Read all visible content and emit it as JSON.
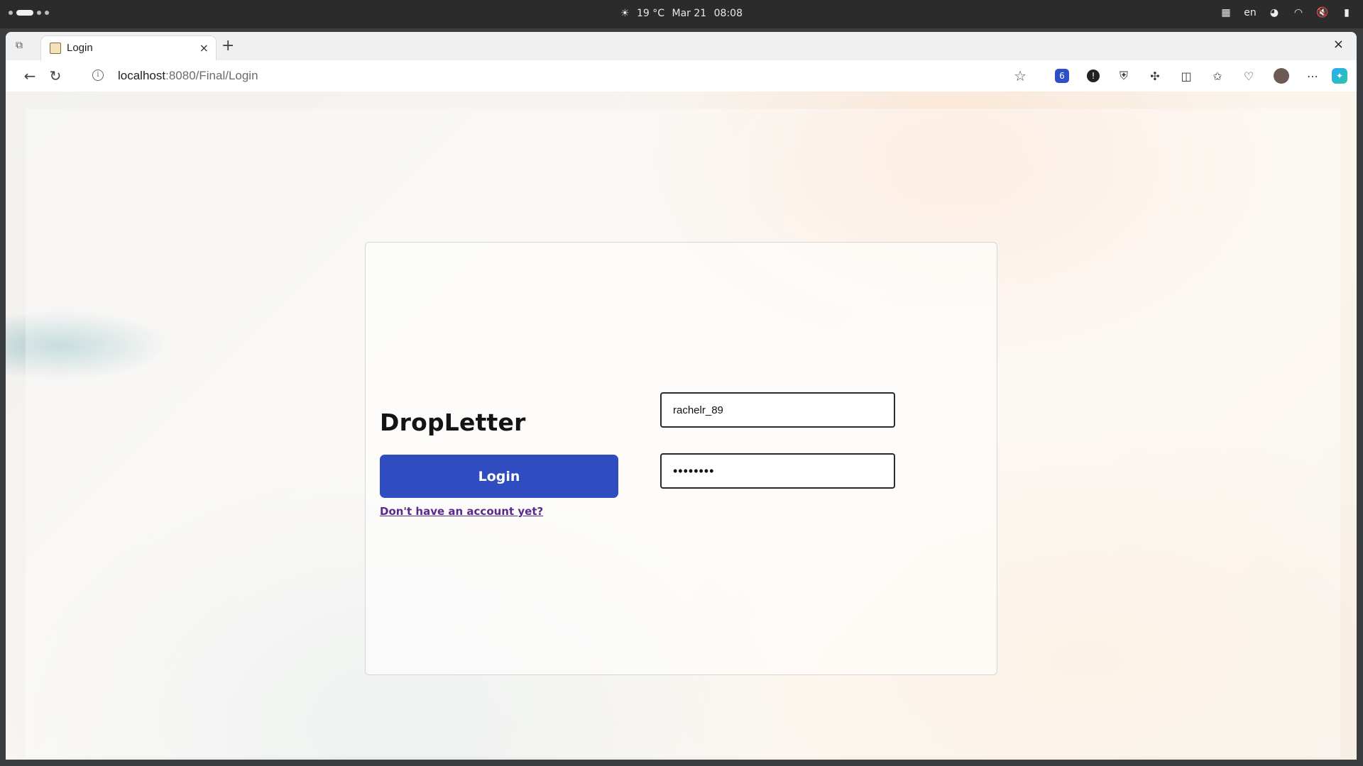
{
  "system_bar": {
    "weather": "19 °C",
    "date": "Mar 21",
    "time": "08:08",
    "language": "en"
  },
  "browser": {
    "tab": {
      "title": "Login",
      "close": "×"
    },
    "new_tab": "+",
    "window_close": "×",
    "url": {
      "host": "localhost",
      "path": ":8080/Final/Login"
    },
    "ext_badge": "6"
  },
  "page": {
    "brand": "DropLetter",
    "login_button": "Login",
    "signup_link": "Don't have an account yet?",
    "username_value": "rachelr_89",
    "password_value": "••••••••"
  },
  "colors": {
    "accent": "#2f4cc0",
    "link": "#5a2a8a"
  }
}
